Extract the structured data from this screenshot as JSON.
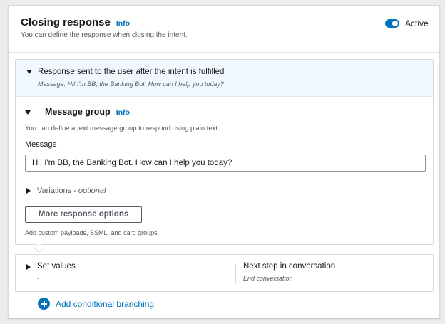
{
  "section": {
    "title": "Closing response",
    "info_label": "Info",
    "subtitle": "You can define the response when closing the intent.",
    "toggle": {
      "label": "Active",
      "state": "on"
    }
  },
  "response_card": {
    "title": "Response sent to the user after the intent is fulfilled",
    "summary": "Message: Hi! I'm BB, the Banking Bot. How can I help you today?",
    "message_group": {
      "title": "Message group",
      "info_label": "Info",
      "description": "You can define a text message group to respond using plain text.",
      "message_label": "Message",
      "message_value": "Hi! I'm BB, the Banking Bot. How can I help you today?",
      "variations_label": "Variations - ",
      "variations_optional": "optional"
    },
    "more_options_button": "More response options",
    "more_options_description": "Add custom payloads, SSML, and card groups."
  },
  "set_values_card": {
    "title": "Set values",
    "value": "-",
    "next_step_title": "Next step in conversation",
    "next_step_value": "End conversation"
  },
  "add_branching": {
    "label": "Add conditional branching"
  },
  "colors": {
    "accent": "#0073bb",
    "text": "#16191f",
    "muted": "#545b64"
  }
}
